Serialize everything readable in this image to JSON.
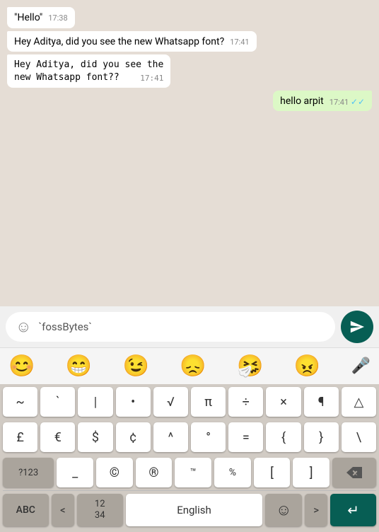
{
  "chat": {
    "messages": [
      {
        "id": 1,
        "type": "incoming",
        "text": "\"Hello\"",
        "time": "17:38",
        "monospace": false,
        "ticks": false
      },
      {
        "id": 2,
        "type": "incoming",
        "text": "Hey Aditya, did you see the new Whatsapp font?",
        "time": "17:41",
        "monospace": false,
        "ticks": false
      },
      {
        "id": 3,
        "type": "incoming",
        "text": "Hey Aditya, did you see the\nnew Whatsapp font??",
        "time": "17:41",
        "monospace": true,
        "ticks": false
      },
      {
        "id": 4,
        "type": "outgoing",
        "text": "hello arpit",
        "time": "17:41",
        "monospace": false,
        "ticks": true
      }
    ]
  },
  "input": {
    "emoji_icon": "☺",
    "text": "`fossBytes`",
    "send_icon": "send"
  },
  "emoji_bar": {
    "emojis": [
      "😊",
      "😁",
      "😉",
      "😞",
      "🤧",
      "😠"
    ],
    "mic": "🎤"
  },
  "keyboard": {
    "row1": [
      "~",
      "`",
      "|",
      "•",
      "√",
      "π",
      "÷",
      "×",
      "¶",
      "△"
    ],
    "row2": [
      "£",
      "€",
      "$",
      "¢",
      "^",
      "°",
      "=",
      "{",
      "}",
      "\\"
    ],
    "row3_left": "?123",
    "row3_underscore": "_",
    "row3_copyright": "©",
    "row3_registered": "®",
    "row3_tm": "™",
    "row3_percent": "%",
    "row3_bracket_open": "[",
    "row3_bracket_close": "]",
    "row3_delete": "⌫",
    "bottom": {
      "abc": "ABC",
      "lt": "<",
      "numbers": "12\n34",
      "space": "English",
      "emoji": "☺",
      "gt": ">",
      "enter": "↵"
    }
  }
}
